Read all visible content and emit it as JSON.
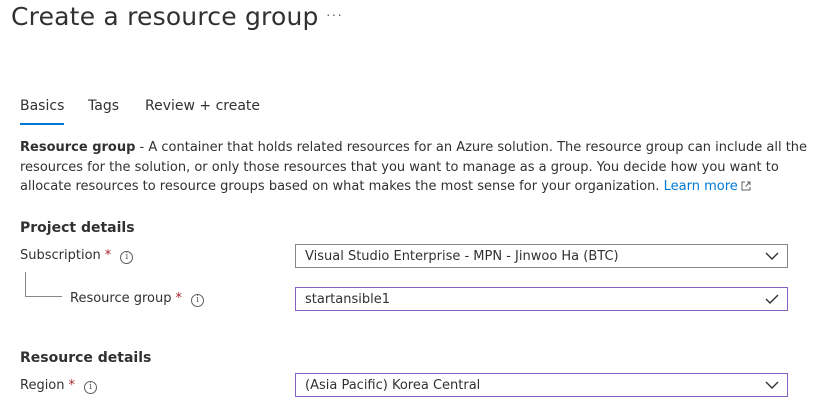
{
  "header": {
    "title": "Create a resource group",
    "more_label": "···"
  },
  "tabs": [
    {
      "label": "Basics",
      "active": true
    },
    {
      "label": "Tags",
      "active": false
    },
    {
      "label": "Review + create",
      "active": false
    }
  ],
  "description": {
    "bold": "Resource group",
    "text": " - A container that holds related resources for an Azure solution. The resource group can include all the resources for the solution, or only those resources that you want to manage as a group. You decide how you want to allocate resources to resource groups based on what makes the most sense for your organization. ",
    "link": "Learn more"
  },
  "project_details": {
    "heading": "Project details",
    "subscription": {
      "label": "Subscription",
      "required_mark": "*",
      "value": "Visual Studio Enterprise - MPN - Jinwoo Ha (BTC)"
    },
    "resource_group": {
      "label": "Resource group",
      "required_mark": "*",
      "value": "startansible1",
      "valid": true
    }
  },
  "resource_details": {
    "heading": "Resource details",
    "region": {
      "label": "Region",
      "required_mark": "*",
      "value": "(Asia Pacific) Korea Central"
    }
  },
  "info_glyph": "i",
  "colors": {
    "accent": "#0078d4",
    "required": "#a4262c",
    "focus_border": "#8661c5"
  }
}
